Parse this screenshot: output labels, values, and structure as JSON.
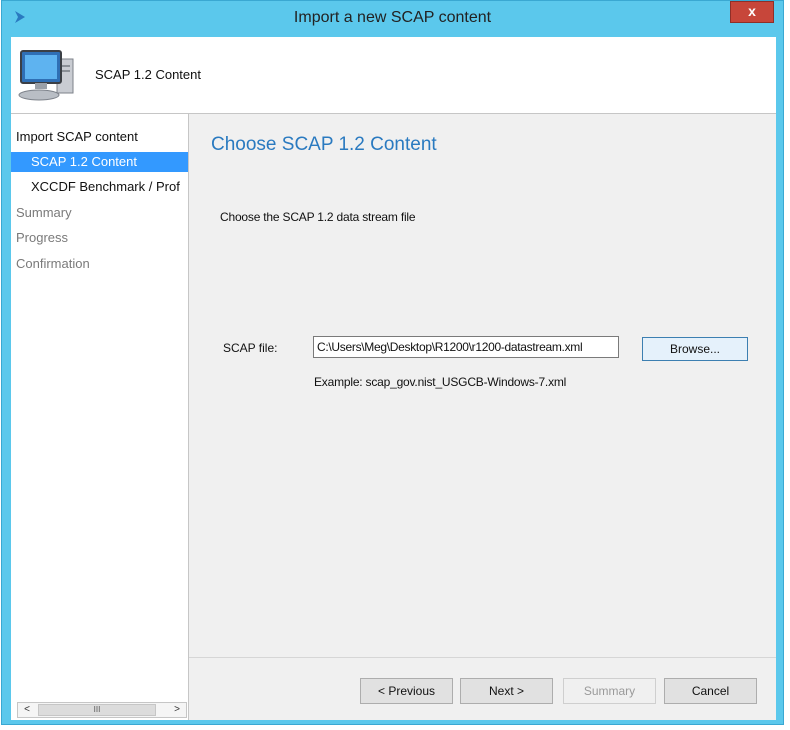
{
  "window": {
    "title": "Import a new SCAP content",
    "close_label": "x"
  },
  "header": {
    "title": "SCAP 1.2 Content",
    "icon": "computer-icon"
  },
  "sidebar": {
    "items": [
      {
        "label": "Import SCAP content",
        "state": "normal"
      },
      {
        "label": "SCAP 1.2 Content",
        "state": "selected"
      },
      {
        "label": "XCCDF Benchmark / Prof",
        "state": "normal"
      },
      {
        "label": "Summary",
        "state": "disabled"
      },
      {
        "label": "Progress",
        "state": "disabled"
      },
      {
        "label": "Confirmation",
        "state": "disabled"
      }
    ],
    "scrollbar": {
      "left": "<",
      "right": ">",
      "thumb_grip": "III"
    }
  },
  "content": {
    "page_title": "Choose SCAP 1.2 Content",
    "instruction": "Choose the SCAP 1.2 data stream file",
    "file_label": "SCAP file:",
    "file_value": "C:\\Users\\Meg\\Desktop\\R1200\\r1200-datastream.xml",
    "browse_label": "Browse...",
    "example": "Example: scap_gov.nist_USGCB-Windows-7.xml"
  },
  "buttons": {
    "previous": "< Previous",
    "next": "Next >",
    "summary": "Summary",
    "cancel": "Cancel"
  },
  "colors": {
    "titlebar": "#5bc8ec",
    "selection": "#3399ff",
    "accent_title": "#2a7ac0",
    "close": "#c7463a"
  }
}
